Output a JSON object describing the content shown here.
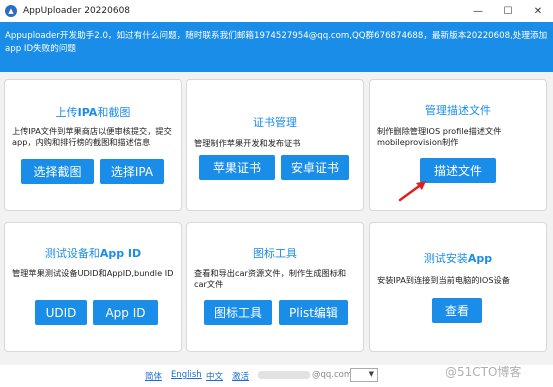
{
  "window": {
    "title": "AppUploader 20220608"
  },
  "header": {
    "notice": "Appuploader开发助手2.0，如过有什么问题，随时联系我们邮箱1974527954@qq.com,QQ群676874688，最新版本20220608,处理添加app ID失败的问题"
  },
  "cards": {
    "upload": {
      "title_prefix": "上传",
      "title_bold": "IPA",
      "title_suffix": "和截图",
      "desc": "上传IPA文件到苹果商店以便审核提交，提交app，内购和排行榜的截图和描述信息",
      "btn1": "选择截图",
      "btn2": "选择IPA"
    },
    "cert": {
      "title": "证书管理",
      "desc": "管理制作苹果开发和发布证书",
      "btn1": "苹果证书",
      "btn2": "安卓证书"
    },
    "profile": {
      "title": "管理描述文件",
      "desc": "制作删除管理IOS profile描述文件mobileprovision制作",
      "btn1": "描述文件"
    },
    "device": {
      "title_prefix": "测试设备和",
      "title_bold": "App ID",
      "desc": "管理苹果测试设备UDID和AppID,bundle ID",
      "btn1": "UDID",
      "btn2": "App ID"
    },
    "icon": {
      "title": "图标工具",
      "desc": "查看和导出car资源文件，制作生成图标和car文件",
      "btn1": "图标工具",
      "btn2": "Plist编辑"
    },
    "install": {
      "title_prefix": "测试安装",
      "title_bold": "App",
      "desc": "安装IPA到连接到当前电脑的IOS设备",
      "btn1": "查看"
    }
  },
  "footer": {
    "links": [
      "简体",
      "English",
      "中文",
      "激活"
    ],
    "email": "@qq.com"
  },
  "watermark": "@51CTO博客",
  "colors": {
    "accent": "#1a8de8",
    "background": "#f2f2f2"
  }
}
